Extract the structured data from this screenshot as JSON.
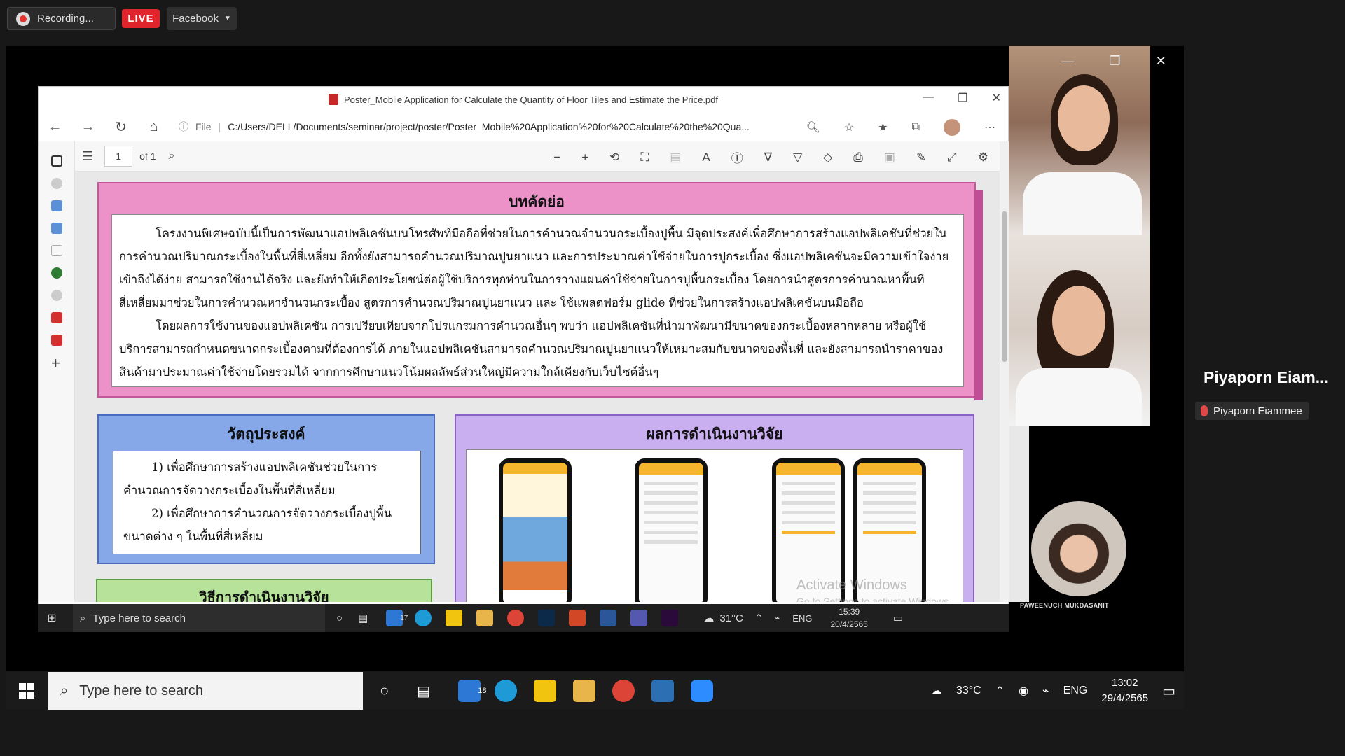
{
  "meeting": {
    "recording_label": "Recording...",
    "live_label": "LIVE",
    "stream_target": "Facebook"
  },
  "browser": {
    "title": "Poster_Mobile Application for Calculate the Quantity of Floor Tiles and Estimate the Price.pdf",
    "file_label": "File",
    "url": "C:/Users/DELL/Documents/seminar/project/poster/Poster_Mobile%20Application%20for%20Calculate%20the%20Qua...",
    "page_number": "1",
    "page_total": "of 1"
  },
  "poster": {
    "abstract_title": "บทคัดย่อ",
    "abstract_p1": "โครงงานพิเศษฉบับนี้เป็นการพัฒนาแอปพลิเคชันบนโทรศัพท์มือถือที่ช่วยในการคำนวณจำนวนกระเบื้องปูพื้น มีจุดประสงค์เพื่อศึกษาการสร้างแอปพลิเคชันที่ช่วยในการคำนวณปริมาณกระเบื้องในพื้นที่สี่เหลี่ยม อีกทั้งยังสามารถคำนวณปริมาณปูนยาแนว และการประมาณค่าใช้จ่ายในการปูกระเบื้อง ซึ่งแอปพลิเคชันจะมีความเข้าใจง่าย เข้าถึงได้ง่าย สามารถใช้งานได้จริง และยังทำให้เกิดประโยชน์ต่อผู้ใช้บริการทุกท่านในการวางแผนค่าใช้จ่ายในการปูพื้นกระเบื้อง โดยการนำสูตรการคำนวณหาพื้นที่สี่เหลี่ยมมาช่วยในการคำนวณหาจำนวนกระเบื้อง สูตรการคำนวณปริมาณปูนยาแนว และ ใช้แพลตฟอร์ม glide ที่ช่วยในการสร้างแอปพลิเคชันบนมือถือ",
    "abstract_p2": "โดยผลการใช้งานของแอปพลิเคชัน การเปรียบเทียบจากโปรแกรมการคำนวณอื่นๆ พบว่า แอปพลิเคชันที่นำมาพัฒนามีขนาดของกระเบื้องหลากหลาย หรือผู้ใช้บริการสามารถกำหนดขนาดกระเบื้องตามที่ต้องการได้ ภายในแอปพลิเคชันสามารถคำนวณปริมาณปูนยาแนวให้เหมาะสมกับขนาดของพื้นที่ และยังสามารถนำราคาของสินค้ามาประมาณค่าใช้จ่ายโดยรวมได้ จากการศึกษาแนวโน้มผลลัพธ์ส่วนใหญ่มีความใกล้เคียงกับเว็บไซต์อื่นๆ",
    "objective_title": "วัตถุประสงค์",
    "objective_1": "1) เพื่อศึกษาการสร้างแอปพลิเคชันช่วยในการคำนวณการจัดวางกระเบื้องในพื้นที่สี่เหลี่ยม",
    "objective_2": "2) เพื่อศึกษาการคำนวณการจัดวางกระเบื้องปูพื้นขนาดต่าง ๆ ในพื้นที่สี่เหลี่ยม",
    "results_title": "ผลการดำเนินงานวิจัย",
    "method_title": "วิธีการดำเนินงานวิจัย"
  },
  "watermark": {
    "line1": "Activate Windows",
    "line2": "Go to Settings to activate Windows."
  },
  "inner_taskbar": {
    "search_placeholder": "Type here to search",
    "mail_badge": "17",
    "weather": "31°C",
    "lang": "ENG",
    "time": "15:39",
    "date": "20/4/2565"
  },
  "participants": {
    "active_speaker_name": "Piyaporn  Eiam...",
    "muted_name": "Piyaporn Eiammee",
    "third_name": "PAWEENUCH MUKDASANIT"
  },
  "outer_taskbar": {
    "search_placeholder": "Type here to search",
    "mail_badge": "18",
    "weather": "33°C",
    "lang": "ENG",
    "time": "13:02",
    "date": "29/4/2565"
  }
}
